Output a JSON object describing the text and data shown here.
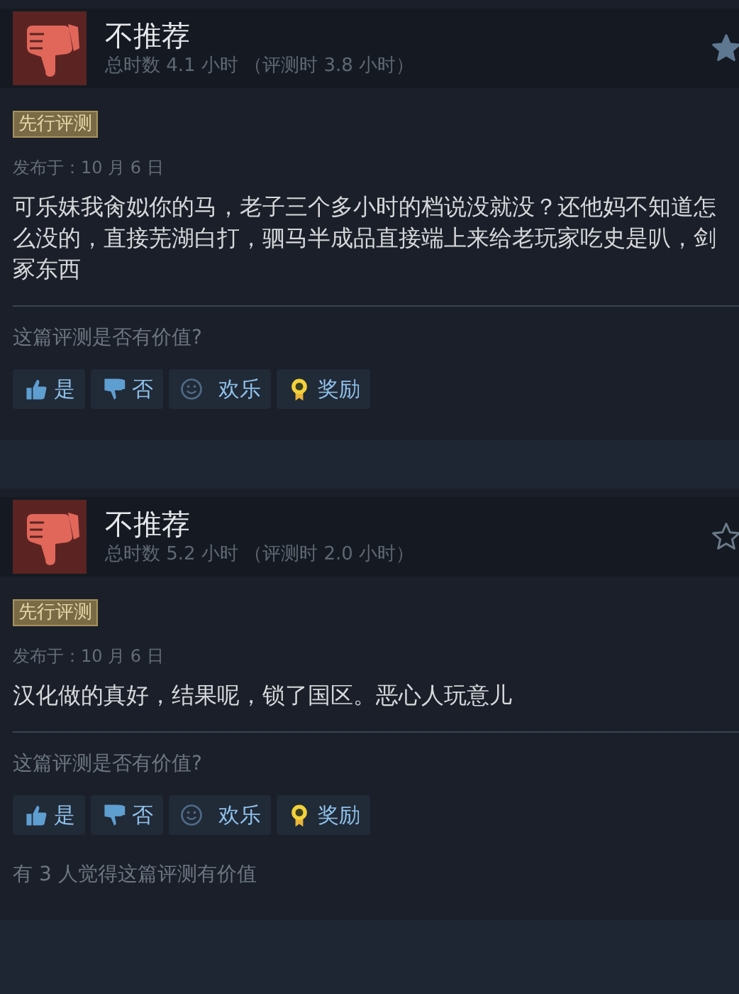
{
  "reviews": [
    {
      "verdict": "不推荐",
      "hours": "总时数 4.1 小时 （评测时 3.8 小时）",
      "starred": true,
      "tag": "先行评测",
      "posted": "发布于：10 月 6 日",
      "text": "可乐妹我肏姒你的马，老子三个多小时的档说没就没？还他妈不知道怎么没的，直接芜湖白打，驷马半成品直接端上来给老玩家吃史是叭，剑冢东西",
      "helpful_prompt": "这篇评测是否有价值?",
      "buttons": [
        {
          "kind": "yes",
          "label": "是"
        },
        {
          "kind": "no",
          "label": "否"
        },
        {
          "kind": "funny",
          "label": "欢乐"
        },
        {
          "kind": "award",
          "label": "奖励"
        }
      ]
    },
    {
      "verdict": "不推荐",
      "hours": "总时数 5.2 小时 （评测时 2.0 小时）",
      "starred": false,
      "tag": "先行评测",
      "posted": "发布于：10 月 6 日",
      "text": "汉化做的真好，结果呢，锁了国区。恶心人玩意儿",
      "helpful_prompt": "这篇评测是否有价值?",
      "buttons": [
        {
          "kind": "yes",
          "label": "是"
        },
        {
          "kind": "no",
          "label": "否"
        },
        {
          "kind": "funny",
          "label": "欢乐"
        },
        {
          "kind": "award",
          "label": "奖励"
        }
      ],
      "helpful_count": "有 3 人觉得这篇评测有价值"
    }
  ]
}
